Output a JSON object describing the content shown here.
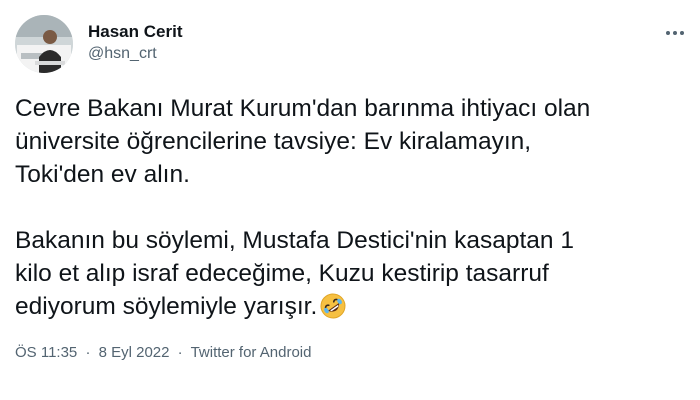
{
  "author": {
    "name": "Hasan Cerit",
    "handle": "@hsn_crt"
  },
  "tweet": {
    "para1": [
      "Cevre Bakanı Murat Kurum'dan barınma ihtiyacı olan",
      "üniversite öğrencilerine tavsiye: Ev kiralamayın,",
      "Toki'den ev alın."
    ],
    "para2": [
      "Bakanın bu söylemi, Mustafa Destici'nin kasaptan 1",
      "kilo et alıp israf edeceğime, Kuzu kestirip tasarruf",
      "ediyorum söylemiyle yarışır."
    ],
    "emoji": "rolling-on-the-floor-laughing"
  },
  "meta": {
    "time": "ÖS 11:35",
    "date": "8 Eyl 2022",
    "separator": "·",
    "client": "Twitter for Android"
  },
  "icons": {
    "more": "more-options-icon"
  }
}
